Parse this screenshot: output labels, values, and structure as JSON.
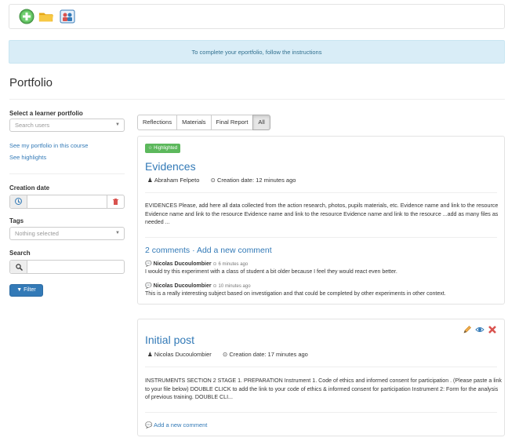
{
  "toolbar": {
    "add_icon": "plus-circle-icon",
    "folder_icon": "folder-icon",
    "users_icon": "users-icon"
  },
  "banner": {
    "text": "To complete your eportfolio, follow the instructions"
  },
  "page": {
    "title": "Portfolio"
  },
  "sidebar": {
    "learner_label": "Select a learner portfolio",
    "learner_placeholder": "Search users",
    "link_my_portfolio": "See my portfolio in this course",
    "link_highlights": "See highlights",
    "creation_date_label": "Creation date",
    "date_value": "",
    "tags_label": "Tags",
    "tags_placeholder": "Nothing selected",
    "search_label": "Search",
    "search_value": "",
    "filter_label": "Filter"
  },
  "tabs": [
    {
      "label": "Reflections",
      "active": false
    },
    {
      "label": "Materials",
      "active": false
    },
    {
      "label": "Final Report",
      "active": false
    },
    {
      "label": "All",
      "active": true
    }
  ],
  "posts": [
    {
      "badge": "Highlighted",
      "title": "Evidences",
      "author": "Abraham Felpeto",
      "created": "Creation date: 12 minutes ago",
      "body": "EVIDENCES Please, add here all data collected from the action research, photos, pupils materials, etc. Evidence name and link to the resource Evidence name and link to the resource Evidence name and link to the resource Evidence name and link to the resource ...add as many files as needed    ...",
      "comments_heading": "2 comments · Add a new comment",
      "comments": [
        {
          "author": "Nicolas Ducoulombier",
          "when": "6 minutes ago",
          "text": "I would try this experiment with a class of student a bit older because I feel they would react even better."
        },
        {
          "author": "Nicolas Ducoulombier",
          "when": "10 minutes ago",
          "text": "This is a really interesting subject based on investigation and that could be completed by other experiments in other context."
        }
      ]
    },
    {
      "title": "Initial post",
      "author": "Nicolas Ducoulombier",
      "created": "Creation date: 17 minutes ago",
      "body": "INSTRUMENTS SECTION 2 STAGE 1. PREPARATION Instrument 1.  Code of ethics and informed consent for participation . (Please paste a link to your file below) DOUBLE CLICK to add the link to your code of ethics & informed consent for participation  Instrument 2: Form for the analysis of previous training. DOUBLE CLI...",
      "add_comment": "Add a new comment",
      "actions": [
        "pencil-icon",
        "eye-icon",
        "delete-x-icon"
      ]
    }
  ],
  "colors": {
    "link": "#337ab7",
    "banner_bg": "#d9edf7",
    "badge_green": "#5cb85c",
    "danger": "#d9534f"
  }
}
